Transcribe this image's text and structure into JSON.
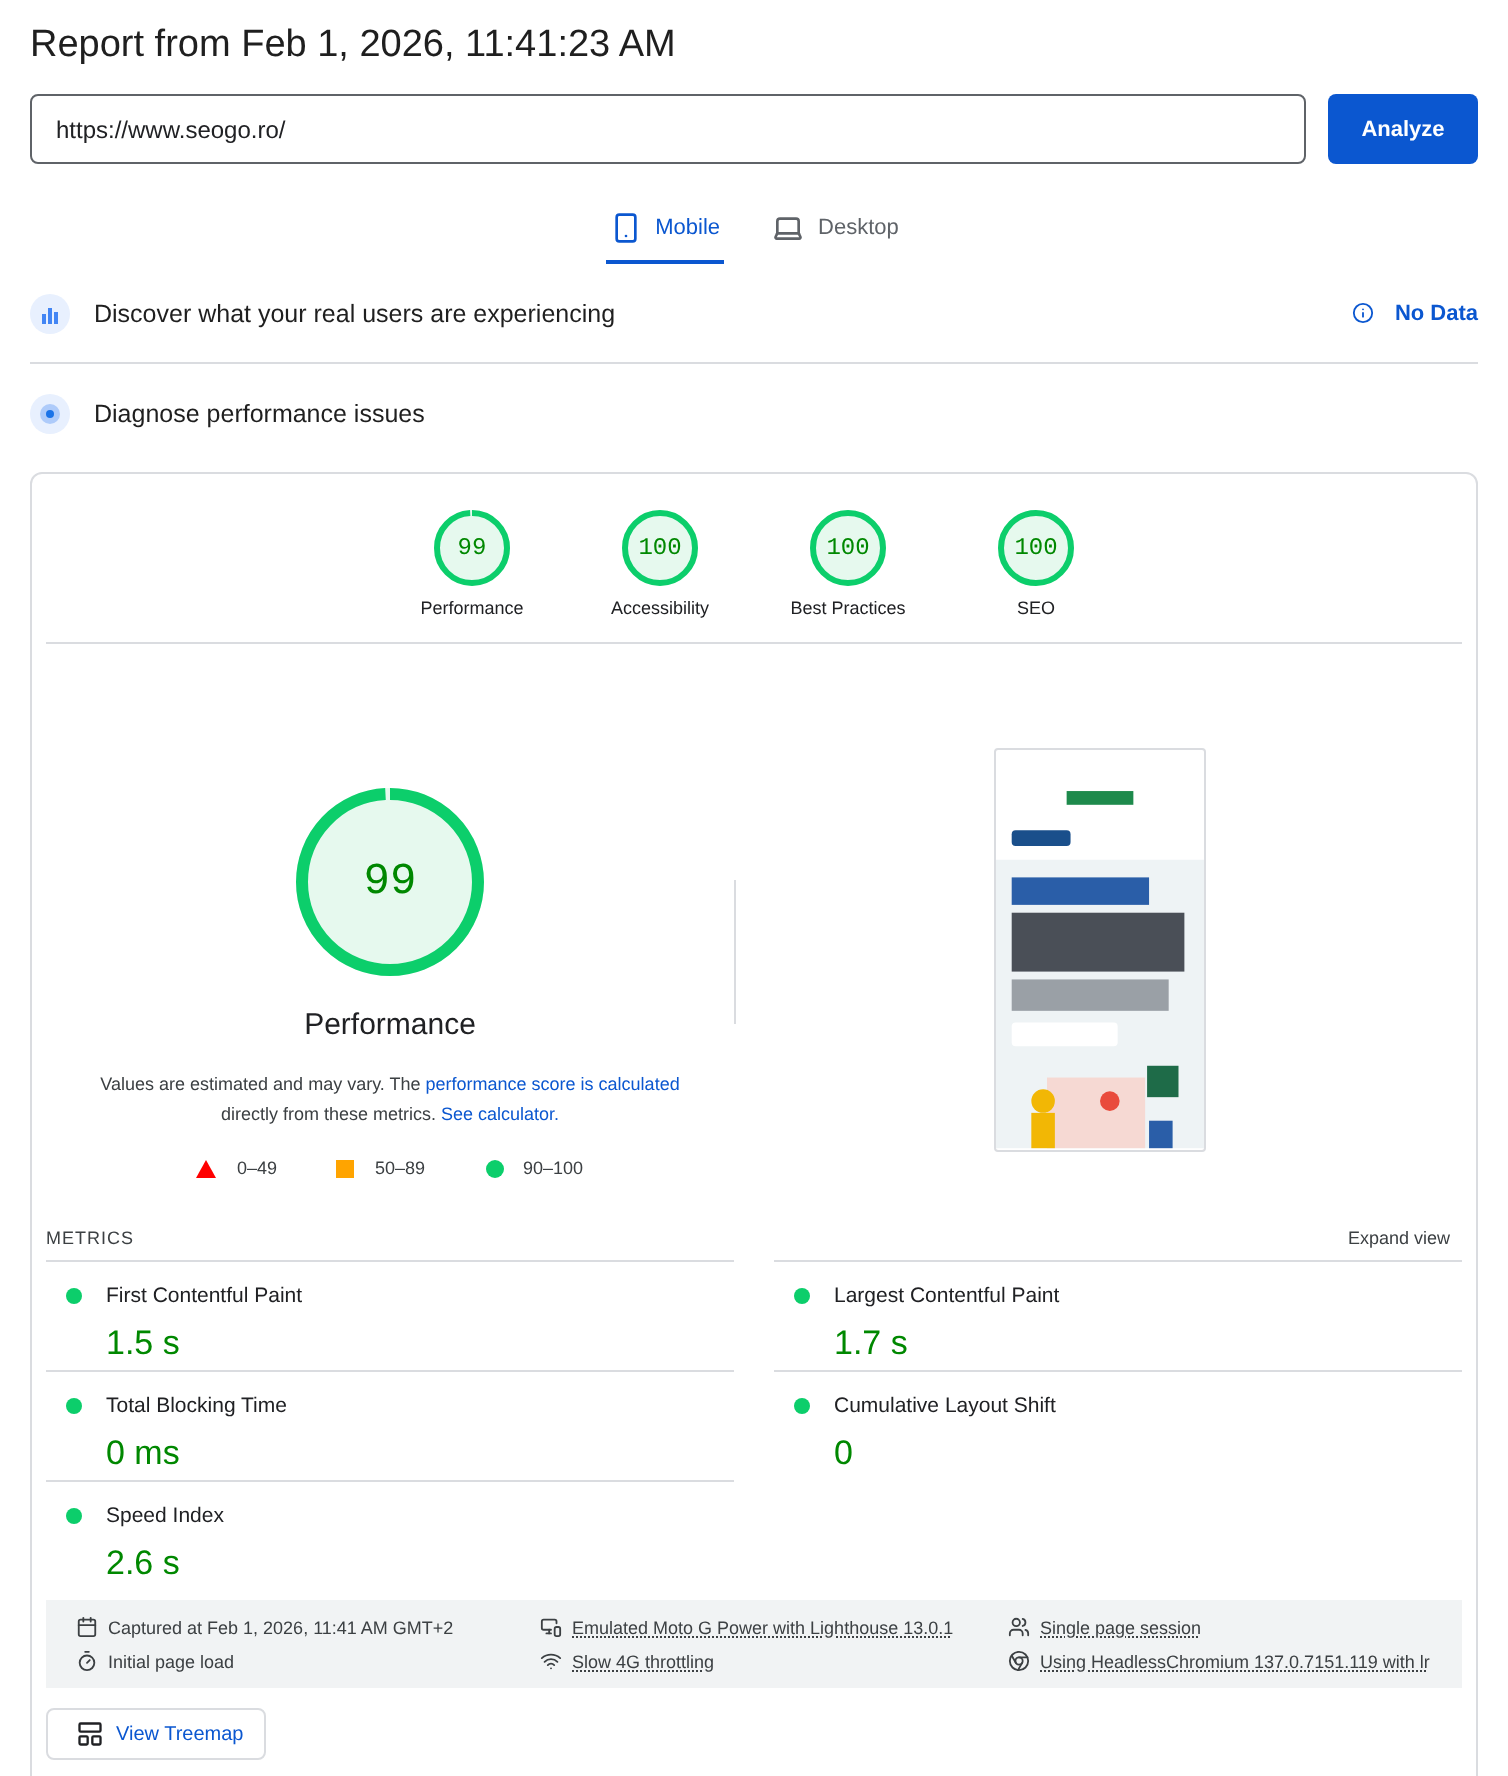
{
  "report_title": "Report from Feb 1, 2026, 11:41:23 AM",
  "url_field": {
    "value": "https://www.seogo.ro/"
  },
  "analyze_button": "Analyze",
  "device_tabs": [
    {
      "label": "Mobile",
      "kind": "mobile",
      "selected": true
    },
    {
      "label": "Desktop",
      "kind": "desktop",
      "selected": false
    }
  ],
  "field_data": {
    "title": "Discover what your real users are experiencing",
    "status": "No Data"
  },
  "diagnose": {
    "title": "Diagnose performance issues"
  },
  "category_scores": [
    {
      "score": "99",
      "label": "Performance",
      "level": 0.99
    },
    {
      "score": "100",
      "label": "Accessibility",
      "level": 1
    },
    {
      "score": "100",
      "label": "Best Practices",
      "level": 1
    },
    {
      "score": "100",
      "label": "SEO",
      "level": 1
    }
  ],
  "main_score": {
    "score": "99",
    "label": "Performance",
    "level": 0.99
  },
  "note": [
    {
      "kind": "text",
      "text": "Values are estimated and may vary. The "
    },
    {
      "kind": "link",
      "text": "performance score is calculated"
    },
    {
      "kind": "text",
      "text": " directly from these metrics. "
    },
    {
      "kind": "link",
      "text": "See calculator."
    }
  ],
  "legend": [
    {
      "kind": "triangle",
      "range": "0–49",
      "color": "#ff0000"
    },
    {
      "kind": "square",
      "range": "50–89",
      "color": "#ffa400"
    },
    {
      "kind": "circle",
      "range": "90–100",
      "color": "#0cce6b"
    }
  ],
  "metrics_header": "METRICS",
  "expand_view": "Expand view",
  "metrics": [
    {
      "name": "First Contentful Paint",
      "value": "1.5 s",
      "color": "#0cce6b"
    },
    {
      "name": "Largest Contentful Paint",
      "value": "1.7 s",
      "color": "#0cce6b"
    },
    {
      "name": "Total Blocking Time",
      "value": "0 ms",
      "color": "#0cce6b"
    },
    {
      "name": "Cumulative Layout Shift",
      "value": "0",
      "color": "#0cce6b"
    },
    {
      "name": "Speed Index",
      "value": "2.6 s",
      "color": "#0cce6b"
    }
  ],
  "runtime_info": [
    {
      "kind": "captured",
      "text": "Captured at Feb 1, 2026, 11:41 AM GMT+2"
    },
    {
      "kind": "device",
      "text": "Emulated Moto G Power with Lighthouse 13.0.1"
    },
    {
      "kind": "session",
      "text": "Single page session"
    },
    {
      "kind": "load",
      "text": "Initial page load"
    },
    {
      "kind": "network",
      "text": "Slow 4G throttling"
    },
    {
      "kind": "browser",
      "text": "Using HeadlessChromium 137.0.7151.119 with lr"
    }
  ],
  "treemap_button": "View Treemap"
}
